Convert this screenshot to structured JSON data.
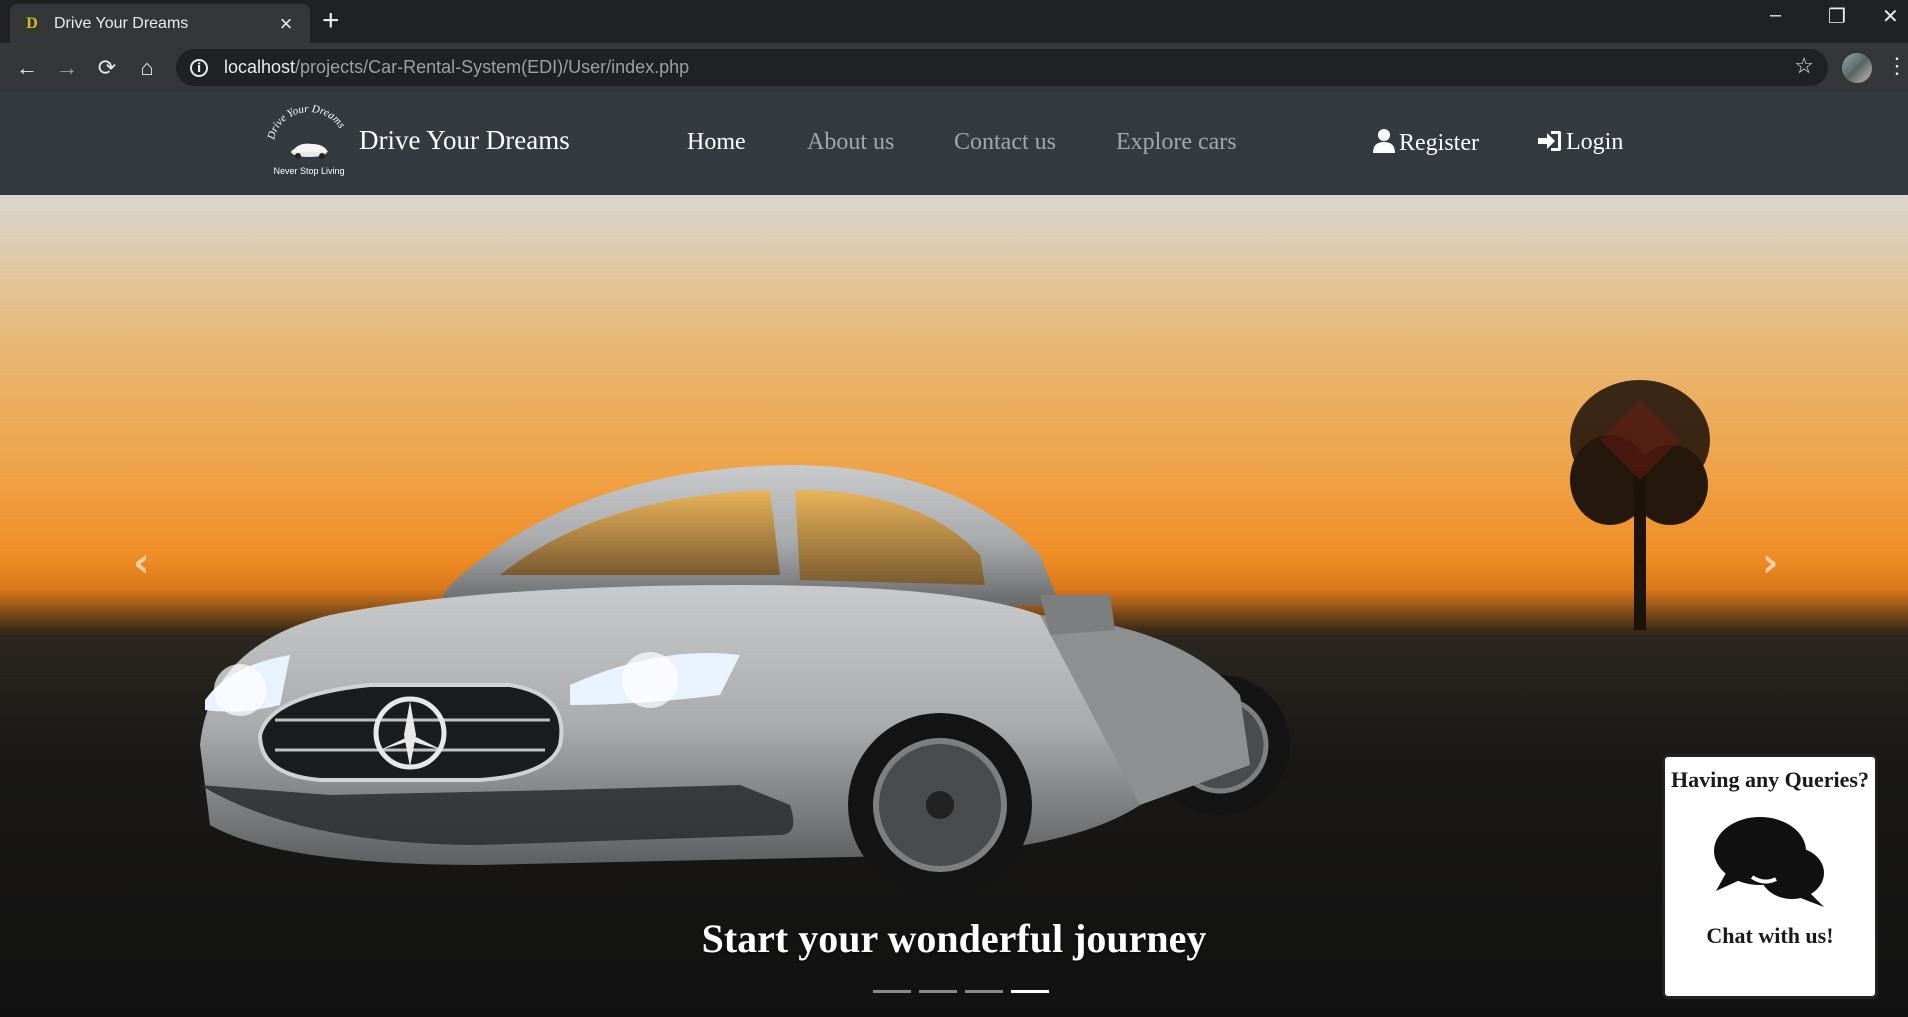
{
  "browser": {
    "tab_title": "Drive Your Dreams",
    "favicon_letter": "D",
    "url_host": "localhost",
    "url_path": "/projects/Car-Rental-System(EDI)/User/index.php"
  },
  "site": {
    "brand": "Drive Your Dreams",
    "logo_text_top": "Drive Your Dreams",
    "logo_tagline": "Never Stop Living",
    "nav": {
      "home": "Home",
      "about": "About us",
      "contact": "Contact us",
      "explore": "Explore cars",
      "register": "Register",
      "login": "Login"
    }
  },
  "carousel": {
    "caption": "Start your wonderful journey",
    "slide_count": 4,
    "active_slide": 4,
    "prev_glyph": "‹",
    "next_glyph": "›"
  },
  "chat": {
    "question": "Having any Queries?",
    "cta": "Chat with us!"
  },
  "colors": {
    "navbar": "#343a40",
    "chrome_dark": "#202124",
    "chrome_light": "#35363a"
  }
}
